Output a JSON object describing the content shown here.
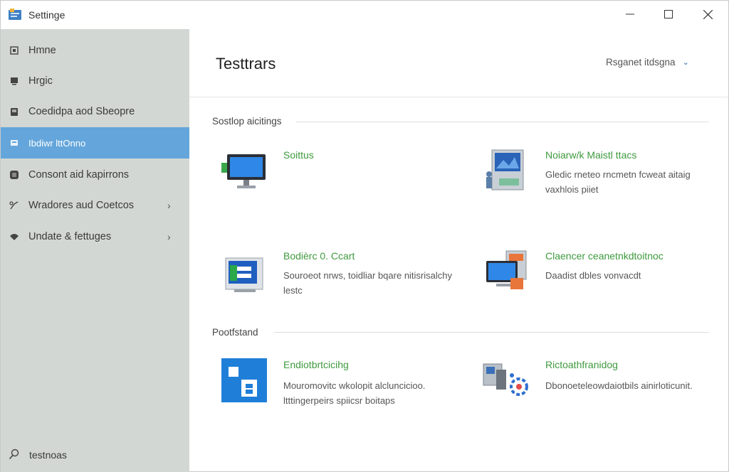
{
  "window": {
    "title": "Settinge",
    "controls": {
      "minimize": "minimize",
      "maximize": "maximize",
      "close": "close"
    }
  },
  "sidebar": {
    "items": [
      {
        "label": "Hmne",
        "icon": "home-icon",
        "chevron": ""
      },
      {
        "label": "Hrgic",
        "icon": "display-icon",
        "chevron": ""
      },
      {
        "label": "Coedidpa aod Sbeopre",
        "icon": "devices-icon",
        "chevron": ""
      },
      {
        "label": "Ibdiwr lttOnno",
        "icon": "personalization-icon",
        "chevron": "",
        "selected": true
      },
      {
        "label": "Consont aid kapirrons",
        "icon": "apps-icon",
        "chevron": ""
      },
      {
        "label": "Wradores aud Coetcos",
        "icon": "accounts-icon",
        "chevron": "›"
      },
      {
        "label": "Undate & fettuges",
        "icon": "update-icon",
        "chevron": "›"
      }
    ],
    "search_label": "testnoas"
  },
  "header": {
    "title": "Testtrars",
    "dropdown_label": "Rsganet itdsgna",
    "dropdown_chevron": "⌄"
  },
  "sections": [
    {
      "title": "Sostlop aicitings",
      "cards": [
        {
          "title": "Soittus",
          "desc": "",
          "icon": "monitor-icon"
        },
        {
          "title": "Noiarw/k Maistl ttacs",
          "desc": "Gledic rneteo rncmetn fcweat aitaig vaxhlois piiet",
          "icon": "network-display-icon"
        },
        {
          "title": "Bodièrc 0. Ccart",
          "desc": "Souroeot nrws, toidliar bqare nitisrisalchy lestc",
          "icon": "system-window-icon"
        },
        {
          "title": "Claencer ceanetnkdtoitnoc",
          "desc": "Daadist dbles vonvacdt",
          "icon": "desktop-tools-icon"
        }
      ]
    },
    {
      "title": "Pootfstand",
      "cards": [
        {
          "title": "Endiotbrtcicihg",
          "desc": "Mouromovitc wkolopit alcluncicioo. ltttingerpeirs spiicsr boitaps",
          "icon": "tiles-icon"
        },
        {
          "title": "Rictoathfranidog",
          "desc": "Dbonoeteleowdaiotbils ainirloticunit.",
          "icon": "gear-computer-icon"
        }
      ]
    }
  ],
  "colors": {
    "sidebar_bg": "#d2d7d3",
    "selected_bg": "#64a6db",
    "accent_blue": "#2d6fb0",
    "card_title_green": "#3f9a3f"
  }
}
